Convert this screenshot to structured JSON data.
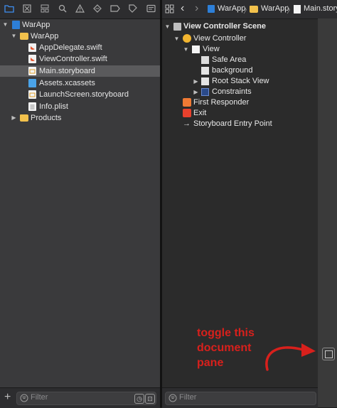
{
  "left_toolbar": {
    "icons": [
      "folder-icon",
      "source-control-icon",
      "hierarchy-icon",
      "search-icon",
      "warning-icon",
      "test-diamond-icon",
      "breakpoint-icon",
      "tag-icon",
      "report-icon"
    ]
  },
  "navigator": {
    "items": [
      {
        "label": "WarApp",
        "icon": "project-icon",
        "disclosure": "▼"
      },
      {
        "label": "WarApp",
        "icon": "folder-icon",
        "disclosure": "▼"
      },
      {
        "label": "AppDelegate.swift",
        "icon": "swift-file-icon"
      },
      {
        "label": "ViewController.swift",
        "icon": "swift-file-icon"
      },
      {
        "label": "Main.storyboard",
        "icon": "storyboard-file-icon",
        "selected": true
      },
      {
        "label": "Assets.xcassets",
        "icon": "assets-icon"
      },
      {
        "label": "LaunchScreen.storyboard",
        "icon": "storyboard-file-icon"
      },
      {
        "label": "Info.plist",
        "icon": "plist-file-icon"
      },
      {
        "label": "Products",
        "icon": "folder-icon",
        "disclosure": "▶"
      }
    ],
    "filter_placeholder": "Filter",
    "add_label": "+"
  },
  "breadcrumb": {
    "items": [
      "WarApp",
      "WarApp",
      "Main.story"
    ]
  },
  "outline": {
    "items": [
      {
        "label": "View Controller Scene",
        "disclosure": "▼"
      },
      {
        "label": "View Controller",
        "disclosure": "▼"
      },
      {
        "label": "View",
        "disclosure": "▼"
      },
      {
        "label": "Safe Area"
      },
      {
        "label": "background"
      },
      {
        "label": "Root Stack View",
        "disclosure": "▶"
      },
      {
        "label": "Constraints",
        "disclosure": "▶"
      },
      {
        "label": "First Responder"
      },
      {
        "label": "Exit"
      },
      {
        "label": "Storyboard Entry Point"
      }
    ],
    "filter_placeholder": "Filter"
  },
  "annotation": {
    "line1": "toggle this",
    "line2": "document",
    "line3": "pane"
  },
  "colors": {
    "accent": "#3f8ef0",
    "annotation": "#d8201c",
    "folder": "#f2c14c"
  }
}
